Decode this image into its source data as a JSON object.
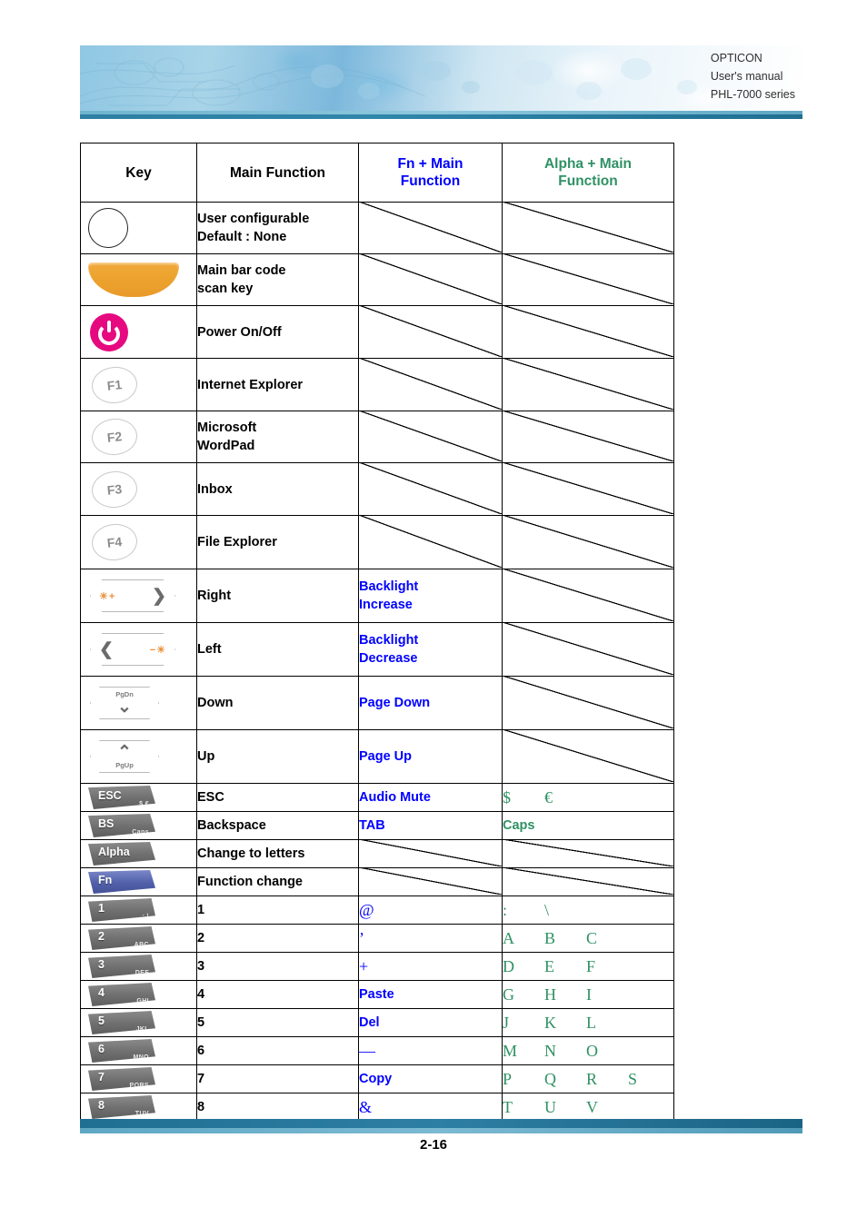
{
  "header": {
    "brand": "OPTICON",
    "doc_type": "User's manual",
    "model": "PHL-7000 series"
  },
  "table": {
    "columns": [
      {
        "id": "key",
        "label": "Key",
        "color": "#000000"
      },
      {
        "id": "main",
        "label": "Main Function",
        "color": "#000000"
      },
      {
        "id": "fn",
        "label": "Fn + Main Function",
        "color": "#0000ff"
      },
      {
        "id": "alpha",
        "label": "Alpha + Main Function",
        "color": "#2f9163"
      }
    ],
    "header_fn_line1": "Fn + Main",
    "header_fn_line2": "Function",
    "header_alpha_line1": "Alpha + Main",
    "header_alpha_line2": "Function",
    "rows": [
      {
        "key_icon": "round-blank-key-icon",
        "key_label": "",
        "main_line1": "User configurable",
        "main_line2": "Default : None",
        "fn": "",
        "alpha": ""
      },
      {
        "key_icon": "scan-trigger-key-icon",
        "key_label": "",
        "main_line1": "Main bar code",
        "main_line2": "scan key",
        "fn": "",
        "alpha": ""
      },
      {
        "key_icon": "power-key-icon",
        "key_label": "",
        "main_line1": "Power On/Off",
        "main_line2": "",
        "fn": "",
        "alpha": ""
      },
      {
        "key_icon": "f1-key-icon",
        "key_label": "F1",
        "main_line1": "Internet Explorer",
        "main_line2": "",
        "fn": "",
        "alpha": ""
      },
      {
        "key_icon": "f2-key-icon",
        "key_label": "F2",
        "main_line1": "Microsoft",
        "main_line2": "WordPad",
        "fn": "",
        "alpha": ""
      },
      {
        "key_icon": "f3-key-icon",
        "key_label": "F3",
        "main_line1": "Inbox",
        "main_line2": "",
        "fn": "",
        "alpha": ""
      },
      {
        "key_icon": "f4-key-icon",
        "key_label": "F4",
        "main_line1": "File Explorer",
        "main_line2": "",
        "fn": "",
        "alpha": ""
      },
      {
        "key_icon": "right-arrow-key-icon",
        "key_label": "",
        "main_line1": "Right",
        "main_line2": "",
        "fn_line1": "Backlight",
        "fn_line2": "Increase",
        "alpha": ""
      },
      {
        "key_icon": "left-arrow-key-icon",
        "key_label": "",
        "main_line1": "Left",
        "main_line2": "",
        "fn_line1": "Backlight",
        "fn_line2": "Decrease",
        "alpha": ""
      },
      {
        "key_icon": "down-arrow-key-icon",
        "key_label": "PgDn",
        "main_line1": "Down",
        "main_line2": "",
        "fn_line1": "Page Down",
        "fn_line2": "",
        "alpha": ""
      },
      {
        "key_icon": "up-arrow-key-icon",
        "key_label": "PgUp",
        "main_line1": "Up",
        "main_line2": "",
        "fn_line1": "Page Up",
        "fn_line2": "",
        "alpha": ""
      },
      {
        "key_icon": "esc-key-icon",
        "key_label": "ESC",
        "key_sub": "$ €",
        "main_line1": "ESC",
        "main_line2": "",
        "fn_line1": "Audio Mute",
        "fn_line2": "",
        "alpha_chars": [
          "$",
          "€"
        ]
      },
      {
        "key_icon": "backspace-key-icon",
        "key_label": "BS",
        "key_sub": "Caps",
        "main_line1": "Backspace",
        "main_line2": "",
        "fn_line1": "TAB",
        "fn_line2": "",
        "alpha": "Caps"
      },
      {
        "key_icon": "alpha-key-icon",
        "key_label": "Alpha",
        "main_line1": "Change to letters",
        "main_line2": "",
        "fn": "",
        "alpha": ""
      },
      {
        "key_icon": "fn-key-icon",
        "key_label": "Fn",
        "main_line1": "Function change",
        "main_line2": "",
        "fn": "",
        "alpha": ""
      },
      {
        "key_icon": "num1-key-icon",
        "key_label": "1",
        "key_sub": ": \\",
        "main_line1": "1",
        "main_line2": "",
        "fn_line1": "@",
        "fn_line2": "",
        "alpha_chars": [
          ":",
          "\\"
        ]
      },
      {
        "key_icon": "num2-key-icon",
        "key_label": "2",
        "key_sub": "ABC",
        "main_line1": "2",
        "main_line2": "",
        "fn_line1": "’",
        "fn_line2": "",
        "alpha_chars": [
          "A",
          "B",
          "C"
        ]
      },
      {
        "key_icon": "num3-key-icon",
        "key_label": "3",
        "key_sub": "DEF",
        "main_line1": "3",
        "main_line2": "",
        "fn_line1": "+",
        "fn_line2": "",
        "alpha_chars": [
          "D",
          "E",
          "F"
        ]
      },
      {
        "key_icon": "num4-key-icon",
        "key_label": "4",
        "key_sub": "GHI",
        "main_line1": "4",
        "main_line2": "",
        "fn_line1": "Paste",
        "fn_line2": "",
        "alpha_chars": [
          "G",
          "H",
          "I"
        ]
      },
      {
        "key_icon": "num5-key-icon",
        "key_label": "5",
        "key_sub": "JKL",
        "main_line1": "5",
        "main_line2": "",
        "fn_line1": "Del",
        "fn_line2": "",
        "alpha_chars": [
          "J",
          "K",
          "L"
        ]
      },
      {
        "key_icon": "num6-key-icon",
        "key_label": "6",
        "key_sub": "MNO",
        "main_line1": "6",
        "main_line2": "",
        "fn_line1": "—",
        "fn_line2": "",
        "alpha_chars": [
          "M",
          "N",
          "O"
        ]
      },
      {
        "key_icon": "num7-key-icon",
        "key_label": "7",
        "key_sub": "PQRS",
        "main_line1": "7",
        "main_line2": "",
        "fn_line1": "Copy",
        "fn_line2": "",
        "alpha_chars": [
          "P",
          "Q",
          "R",
          "S"
        ]
      },
      {
        "key_icon": "num8-key-icon",
        "key_label": "8",
        "key_sub": "TUV",
        "main_line1": "8",
        "main_line2": "",
        "fn_line1": "&",
        "fn_line2": "",
        "alpha_chars": [
          "T",
          "U",
          "V"
        ]
      }
    ]
  },
  "footer": {
    "page_number": "2-16"
  },
  "colors": {
    "fn_blue": "#0000ff",
    "alpha_green": "#2f9163",
    "band_dark": "#2d7fa3",
    "band_light": "#6fb4ce",
    "power_pink": "#e6097f",
    "scan_orange": "#eda32f",
    "fn_key_blue": "#5160a8"
  }
}
